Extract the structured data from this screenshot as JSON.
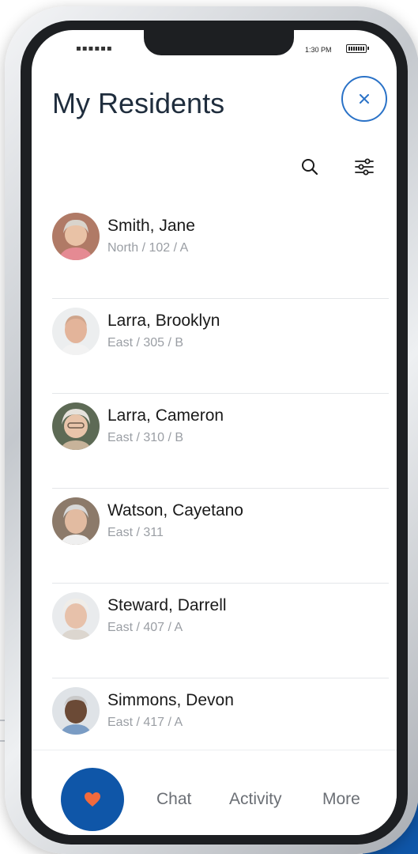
{
  "status_bar": {
    "signal": "▪▪▪▪▪▪",
    "time": "1:30 PM"
  },
  "header": {
    "title": "My Residents",
    "close_label": "×"
  },
  "toolbar": {
    "search_icon": "search-icon",
    "filter_icon": "sliders-icon"
  },
  "residents": [
    {
      "name": "Smith, Jane",
      "location": "North / 102 / A"
    },
    {
      "name": "Larra, Brooklyn",
      "location": "East / 305 / B"
    },
    {
      "name": "Larra, Cameron",
      "location": "East / 310 / B"
    },
    {
      "name": "Watson, Cayetano",
      "location": "East / 311"
    },
    {
      "name": "Steward, Darrell",
      "location": "East / 407 / A"
    },
    {
      "name": "Simmons, Devon",
      "location": "East / 417 / A"
    }
  ],
  "bottom_nav": {
    "home_icon": "heart-icon",
    "items": [
      {
        "label": "Chat"
      },
      {
        "label": "Activity"
      },
      {
        "label": "More"
      }
    ]
  },
  "colors": {
    "accent": "#0f56a8",
    "heart": "#f26a3d",
    "close_ring": "#2a72c7",
    "title": "#1f2d3d",
    "secondary_text": "#9a9ea4"
  }
}
